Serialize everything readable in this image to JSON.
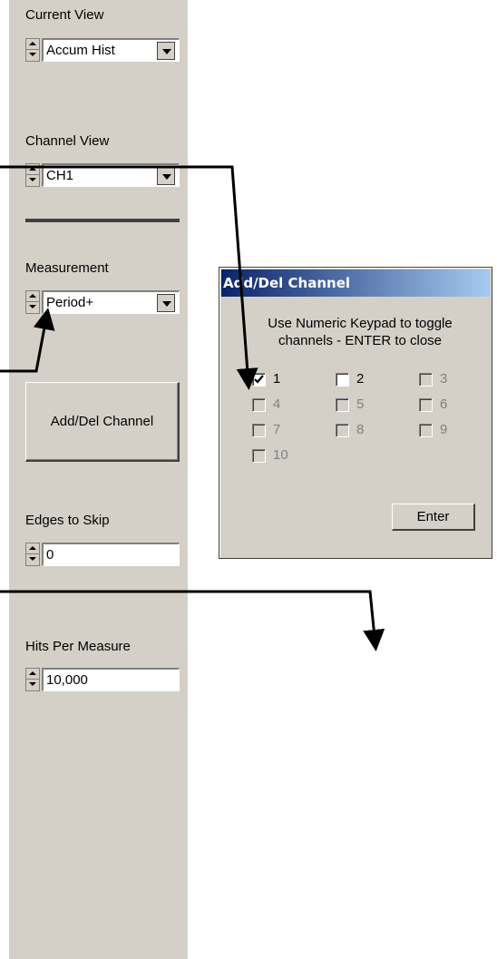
{
  "sidebar": {
    "current_view": {
      "label": "Current View",
      "value": "Accum Hist"
    },
    "channel_view": {
      "label": "Channel View",
      "value": "CH1"
    },
    "measurement": {
      "label": "Measurement",
      "value": "Period+"
    },
    "add_del_button": "Add/Del Channel",
    "edges_to_skip": {
      "label": "Edges to Skip",
      "value": "0"
    },
    "hits_per_measure": {
      "label": "Hits Per Measure",
      "value": "10,000"
    }
  },
  "dialog": {
    "title": "Add/Del Channel",
    "instruction_line1": "Use Numeric Keypad to toggle",
    "instruction_line2": "channels - ENTER to close",
    "channels": [
      {
        "label": "1",
        "checked": true,
        "enabled": true
      },
      {
        "label": "2",
        "checked": false,
        "enabled": true
      },
      {
        "label": "3",
        "checked": false,
        "enabled": false
      },
      {
        "label": "4",
        "checked": false,
        "enabled": false
      },
      {
        "label": "5",
        "checked": false,
        "enabled": false
      },
      {
        "label": "6",
        "checked": false,
        "enabled": false
      },
      {
        "label": "7",
        "checked": false,
        "enabled": false
      },
      {
        "label": "8",
        "checked": false,
        "enabled": false
      },
      {
        "label": "9",
        "checked": false,
        "enabled": false
      },
      {
        "label": "10",
        "checked": false,
        "enabled": false
      }
    ],
    "enter_button": "Enter"
  },
  "colors": {
    "panel": "#d4d0c8",
    "titlebar": "#0a246a",
    "arrow": "#000000"
  }
}
